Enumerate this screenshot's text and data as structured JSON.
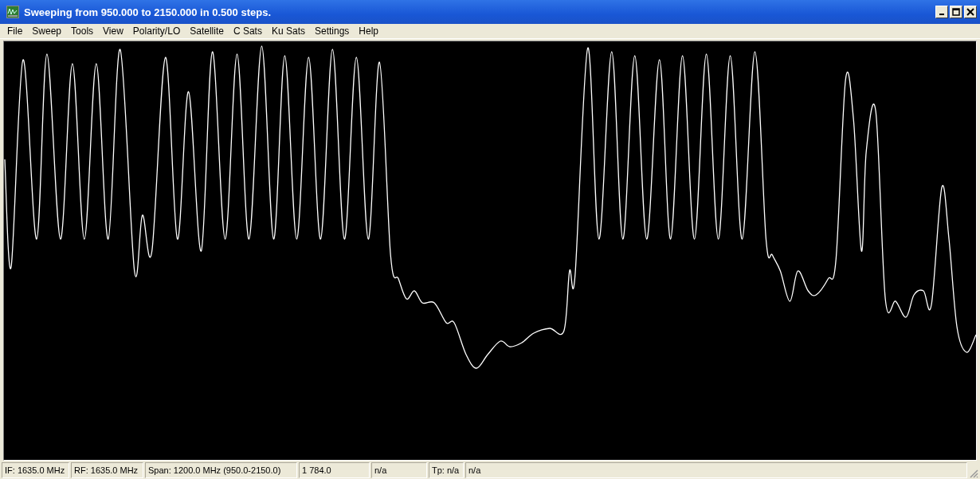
{
  "window": {
    "title": "Sweeping from 950.000 to 2150.000 in 0.500 steps."
  },
  "menu": [
    "File",
    "Sweep",
    "Tools",
    "View",
    "Polarity/LO",
    "Satellite",
    "C Sats",
    "Ku Sats",
    "Settings",
    "Help"
  ],
  "status_bar": [
    {
      "text": "IF: 1635.0 MHz"
    },
    {
      "text": "RF: 1635.0 MHz"
    },
    {
      "text": "Span: 1200.0 MHz (950.0-2150.0)"
    },
    {
      "text": "1 784.0"
    },
    {
      "text": "n/a"
    },
    {
      "text": "Tp: n/a"
    },
    {
      "text": "n/a"
    }
  ]
}
